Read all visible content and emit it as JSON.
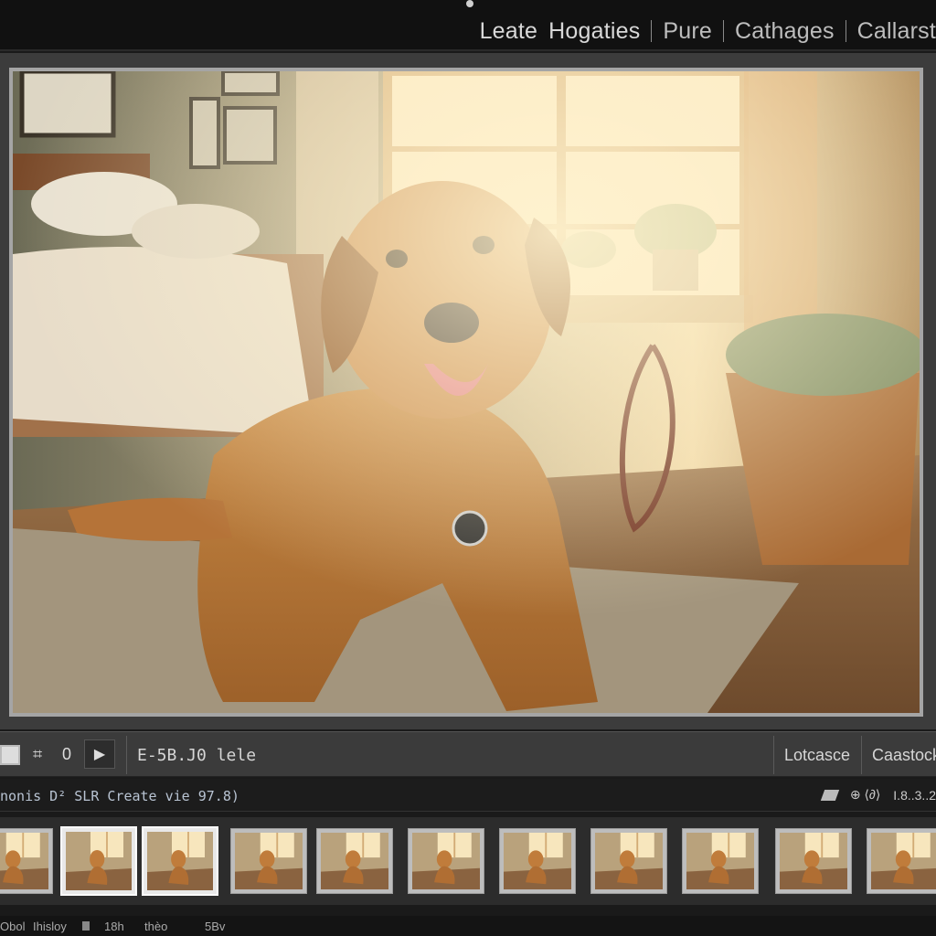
{
  "modules": [
    "Leate",
    "Hogaties",
    "Pure",
    "Cathages",
    "Callarst"
  ],
  "toolbar": {
    "counter": "0",
    "play_label": "▶",
    "crop_icon": "crop-icon",
    "info_label": "E-5B.J0 lele",
    "right_label_1": "Lotcasce",
    "right_label_2": "Caastock"
  },
  "filmstrip_info": {
    "text": "nonis D² SLR Create vie 97.8)",
    "icons_text": "⊕ ⟨∂⟩",
    "count": "I.8..3..2"
  },
  "filmstrip": {
    "selected_indices": [
      1,
      2
    ],
    "thumb_count": 11
  },
  "statusbar": {
    "item1": "Obol",
    "item2": "Ihisloy",
    "item3": "18h",
    "item4": "thèo",
    "item5": "5Bv"
  },
  "colors": {
    "panel": "#3b3b3b",
    "dark": "#111111",
    "photo_warm": "#c8894a"
  }
}
